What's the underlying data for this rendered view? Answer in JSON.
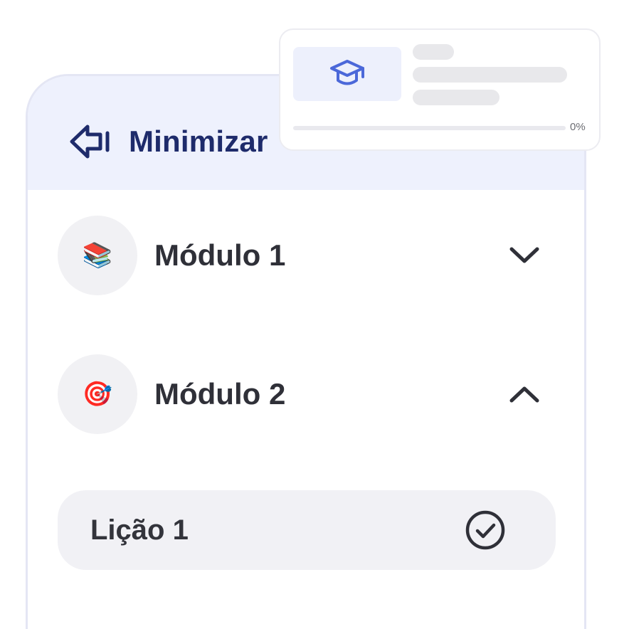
{
  "sidebar": {
    "minimize_label": "Minimizar",
    "minimize_icon": "collapse-arrow-left-icon",
    "modules": [
      {
        "title": "Módulo 1",
        "emoji": "📚",
        "expanded": false,
        "chevron": "chevron-down-icon"
      },
      {
        "title": "Módulo 2",
        "emoji": "🎯",
        "expanded": true,
        "chevron": "chevron-up-icon"
      }
    ],
    "lessons": [
      {
        "title": "Lição 1",
        "completed": true,
        "icon": "check-circle-icon"
      }
    ]
  },
  "course_card": {
    "icon": "graduation-cap-icon",
    "progress_percent": 0,
    "progress_label": "0%"
  },
  "colors": {
    "accent": "#4b68d9",
    "header_bg": "#eef1fd",
    "title_text": "#1e2b6b",
    "body_text": "#2f3038"
  }
}
